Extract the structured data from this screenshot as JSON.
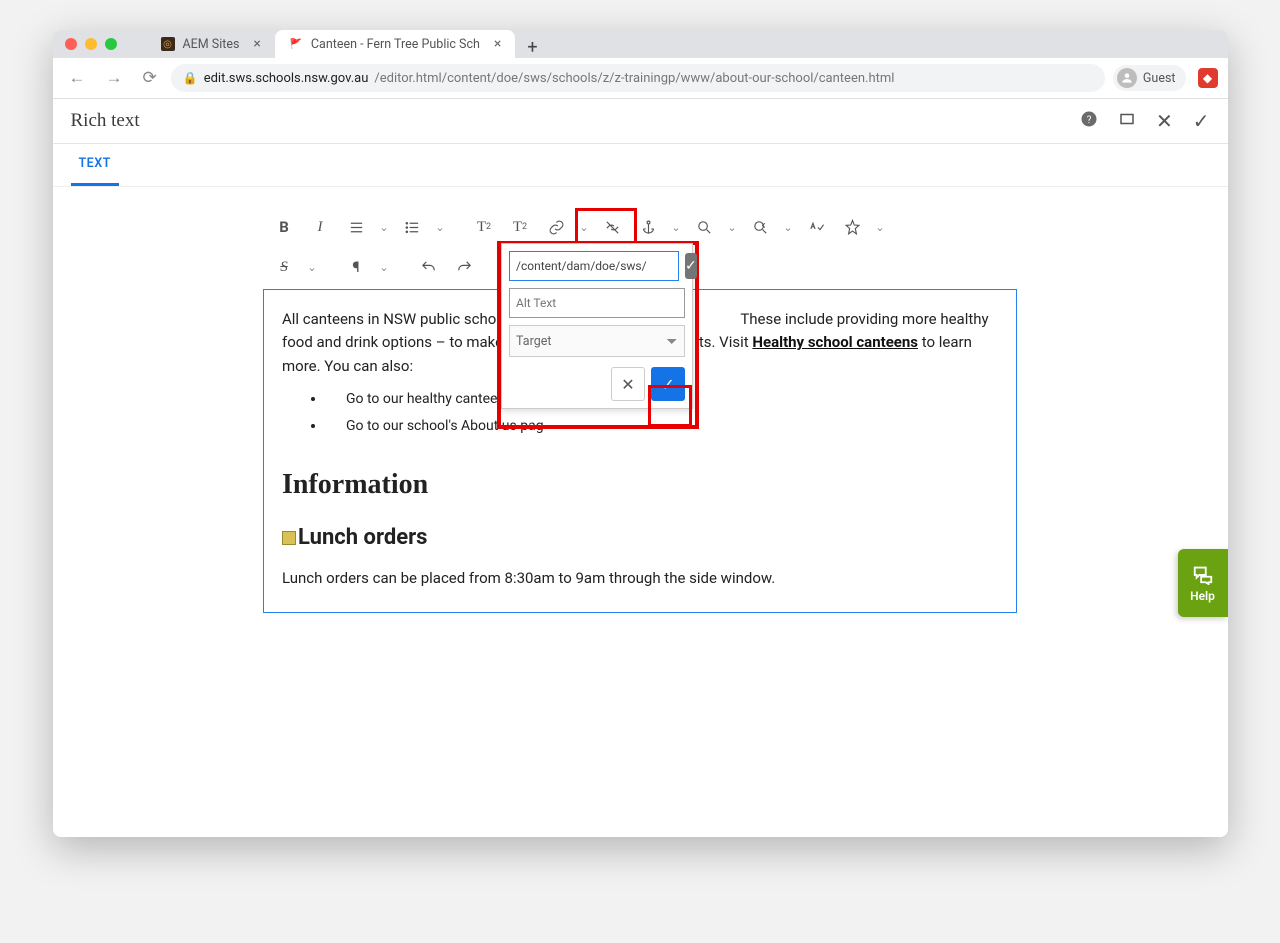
{
  "browser": {
    "tabs": [
      {
        "title": "AEM Sites",
        "active": false
      },
      {
        "title": "Canteen - Fern Tree Public Sch",
        "active": true
      }
    ],
    "guest_label": "Guest",
    "url_host": "edit.sws.schools.nsw.gov.au",
    "url_path": "/editor.html/content/doe/sws/schools/z/z-trainingp/www/about-our-school/canteen.html"
  },
  "aem": {
    "dialog_title": "Rich text",
    "tab_label": "TEXT"
  },
  "link_dialog": {
    "path_value": "/content/dam/doe/sws/",
    "alt_placeholder": "Alt Text",
    "target_label": "Target"
  },
  "content": {
    "p1_a": "All canteens in NSW public schools m",
    "p1_b": "These include providing more healthy food and drink options – to make healthy",
    "p1_c": "ts. Visit ",
    "p1_link": "Healthy school canteens",
    "p1_d": " to learn more. You can also:",
    "li1": "Go to our healthy canteens fact",
    "li2": "Go to our school's About us pag",
    "h2": "Information",
    "h3": "Lunch orders",
    "p2": "Lunch orders can be placed from 8:30am to 9am through the side window."
  },
  "help_label": "Help"
}
